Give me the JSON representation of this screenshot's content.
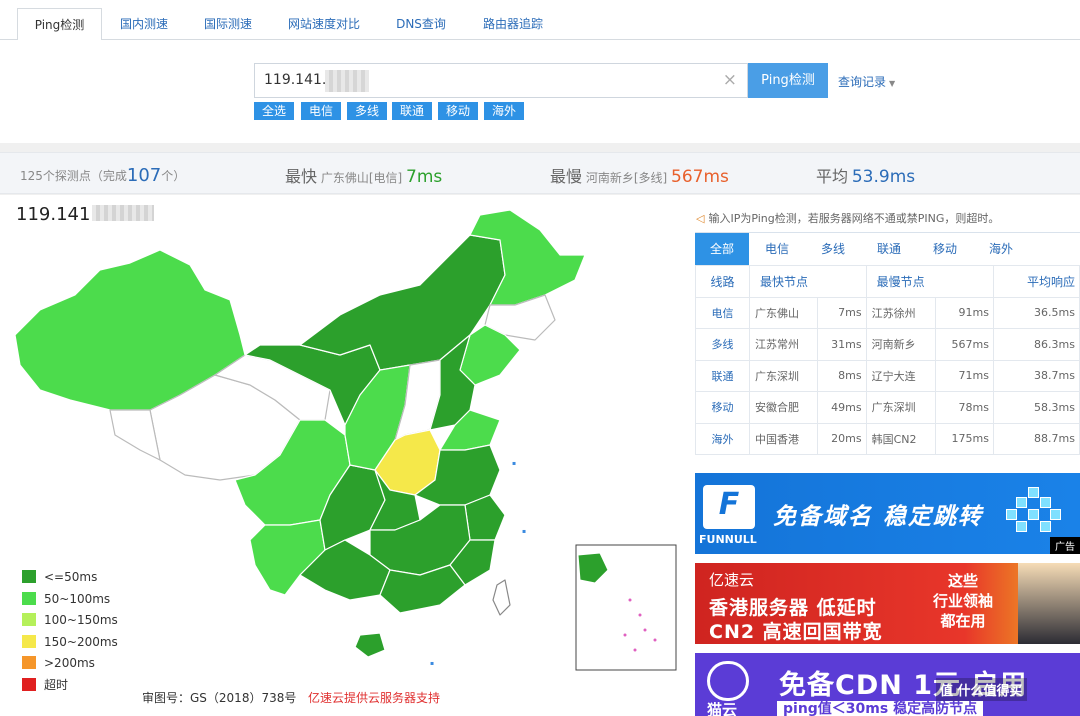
{
  "tabs": [
    "Ping检测",
    "国内测速",
    "国际测速",
    "网站速度对比",
    "DNS查询",
    "路由器追踪"
  ],
  "search": {
    "value": "119.141.",
    "clear_icon": "×",
    "button": "Ping检测",
    "history": "查询记录"
  },
  "filters": [
    "全选",
    "电信",
    "多线",
    "联通",
    "移动",
    "海外"
  ],
  "stats": {
    "points_pre": "125个探测点（完成",
    "points_done": "107",
    "points_post": "个）",
    "fastest_label": "最快",
    "fastest_node": "广东佛山[电信]",
    "fastest_value": "7ms",
    "slowest_label": "最慢",
    "slowest_node": "河南新乡[多线]",
    "slowest_value": "567ms",
    "avg_label": "平均",
    "avg_value": "53.9ms"
  },
  "map": {
    "ip": "119.141",
    "legend": [
      {
        "label": "<=50ms",
        "color": "#2ca02c"
      },
      {
        "label": "50~100ms",
        "color": "#4cdc4c"
      },
      {
        "label": "100~150ms",
        "color": "#b5f05a"
      },
      {
        "label": "150~200ms",
        "color": "#f5e84a"
      },
      {
        "label": ">200ms",
        "color": "#f5962a"
      },
      {
        "label": "超时",
        "color": "#e02020"
      }
    ],
    "approval": "审图号：GS（2018）738号",
    "sponsor": "亿速云提供云服务器支持"
  },
  "hint": "输入IP为Ping检测，若服务器网络不通或禁PING，则超时。",
  "results": {
    "tabs": [
      "全部",
      "电信",
      "多线",
      "联通",
      "移动",
      "海外"
    ],
    "headers": [
      "线路",
      "最快节点",
      "最慢节点",
      "平均响应"
    ],
    "rows": [
      {
        "line": "电信",
        "fast": "广东佛山",
        "fast_ms": "7ms",
        "slow": "江苏徐州",
        "slow_ms": "91ms",
        "avg": "36.5ms"
      },
      {
        "line": "多线",
        "fast": "江苏常州",
        "fast_ms": "31ms",
        "slow": "河南新乡",
        "slow_ms": "567ms",
        "avg": "86.3ms"
      },
      {
        "line": "联通",
        "fast": "广东深圳",
        "fast_ms": "8ms",
        "slow": "辽宁大连",
        "slow_ms": "71ms",
        "avg": "38.7ms"
      },
      {
        "line": "移动",
        "fast": "安徽合肥",
        "fast_ms": "49ms",
        "slow": "广东深圳",
        "slow_ms": "78ms",
        "avg": "58.3ms"
      },
      {
        "line": "海外",
        "fast": "中国香港",
        "fast_ms": "20ms",
        "slow": "韩国CN2",
        "slow_ms": "175ms",
        "avg": "88.7ms"
      }
    ]
  },
  "ads": {
    "ad1_brand": "FUNNULL",
    "ad1_slogan": "免备域名  稳定跳转",
    "ad_tag": "广告",
    "ad2_brand": "亿速云",
    "ad2_line1": "香港服务器 低延时",
    "ad2_line2": "CN2 高速回国带宽",
    "ad2_side": "这些\n行业领袖\n都在用",
    "ad3_cloud": "猫云",
    "ad3_headline": "免备CDN 1元 启用",
    "ad3_sub": "ping值＜30ms 稳定高防节点",
    "watermark": "值 什么值得买"
  }
}
